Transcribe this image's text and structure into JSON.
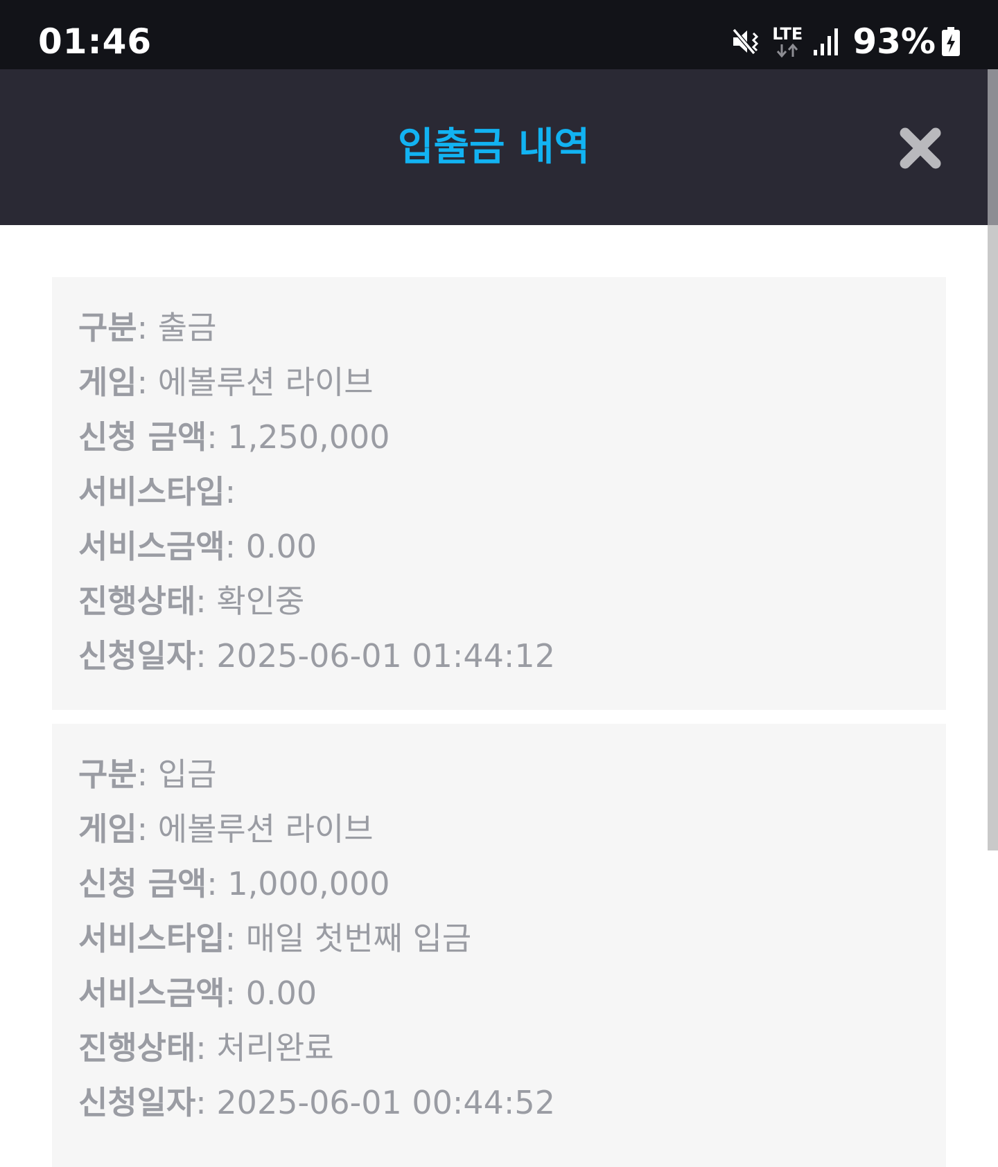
{
  "status_bar": {
    "time": "01:46",
    "network": "LTE",
    "battery": "93%",
    "icons": [
      "mute-icon",
      "lte-data-icon",
      "signal-icon",
      "battery-charging-icon"
    ]
  },
  "header": {
    "title": "입출금 내역",
    "close_icon": "close-icon"
  },
  "colors": {
    "accent": "#12b3f2",
    "header_bg": "#2a2934",
    "status_bg": "#121318",
    "card_bg": "#f6f6f6",
    "text": "#9a9ca3"
  },
  "separator": ": ",
  "records": [
    {
      "fields": [
        {
          "label": "구분",
          "value": "출금"
        },
        {
          "label": "게임",
          "value": "에볼루션 라이브"
        },
        {
          "label": "신청 금액",
          "value": "1,250,000"
        },
        {
          "label": "서비스타입",
          "value": ""
        },
        {
          "label": "서비스금액",
          "value": "0.00"
        },
        {
          "label": "진행상태",
          "value": "확인중"
        },
        {
          "label": "신청일자",
          "value": "2025-06-01 01:44:12"
        }
      ]
    },
    {
      "fields": [
        {
          "label": "구분",
          "value": "입금"
        },
        {
          "label": "게임",
          "value": "에볼루션 라이브"
        },
        {
          "label": "신청 금액",
          "value": "1,000,000"
        },
        {
          "label": "서비스타입",
          "value": "매일 첫번째 입금"
        },
        {
          "label": "서비스금액",
          "value": "0.00"
        },
        {
          "label": "진행상태",
          "value": "처리완료"
        },
        {
          "label": "신청일자",
          "value": "2025-06-01 00:44:52"
        }
      ]
    }
  ]
}
